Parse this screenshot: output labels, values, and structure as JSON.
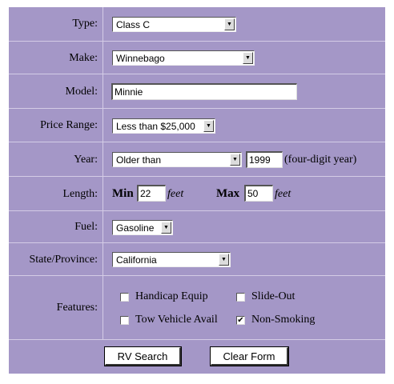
{
  "form": {
    "type": {
      "label": "Type:",
      "value": "Class C"
    },
    "make": {
      "label": "Make:",
      "value": "Winnebago"
    },
    "model": {
      "label": "Model:",
      "value": "Minnie"
    },
    "price": {
      "label": "Price Range:",
      "value": "Less than $25,000"
    },
    "year": {
      "label": "Year:",
      "comparison": "Older than",
      "value": "1999",
      "hint": "(four-digit year)"
    },
    "length": {
      "label": "Length:",
      "min_label": "Min",
      "min_value": "22",
      "max_label": "Max",
      "max_value": "50",
      "unit": "feet"
    },
    "fuel": {
      "label": "Fuel:",
      "value": "Gasoline"
    },
    "state": {
      "label": "State/Province:",
      "value": "California"
    },
    "features": {
      "label": "Features:",
      "options": [
        {
          "label": "Handicap Equip",
          "checked": false
        },
        {
          "label": "Slide-Out",
          "checked": false
        },
        {
          "label": "Tow Vehicle Avail",
          "checked": false
        },
        {
          "label": "Non-Smoking",
          "checked": true
        }
      ]
    },
    "buttons": {
      "search": "RV Search",
      "clear": "Clear Form"
    }
  },
  "colors": {
    "background": "#a497c7",
    "separator": "#d4cce6"
  },
  "icons": {
    "select_arrow": "dropdown-arrow-icon",
    "check": "checkmark-icon"
  }
}
